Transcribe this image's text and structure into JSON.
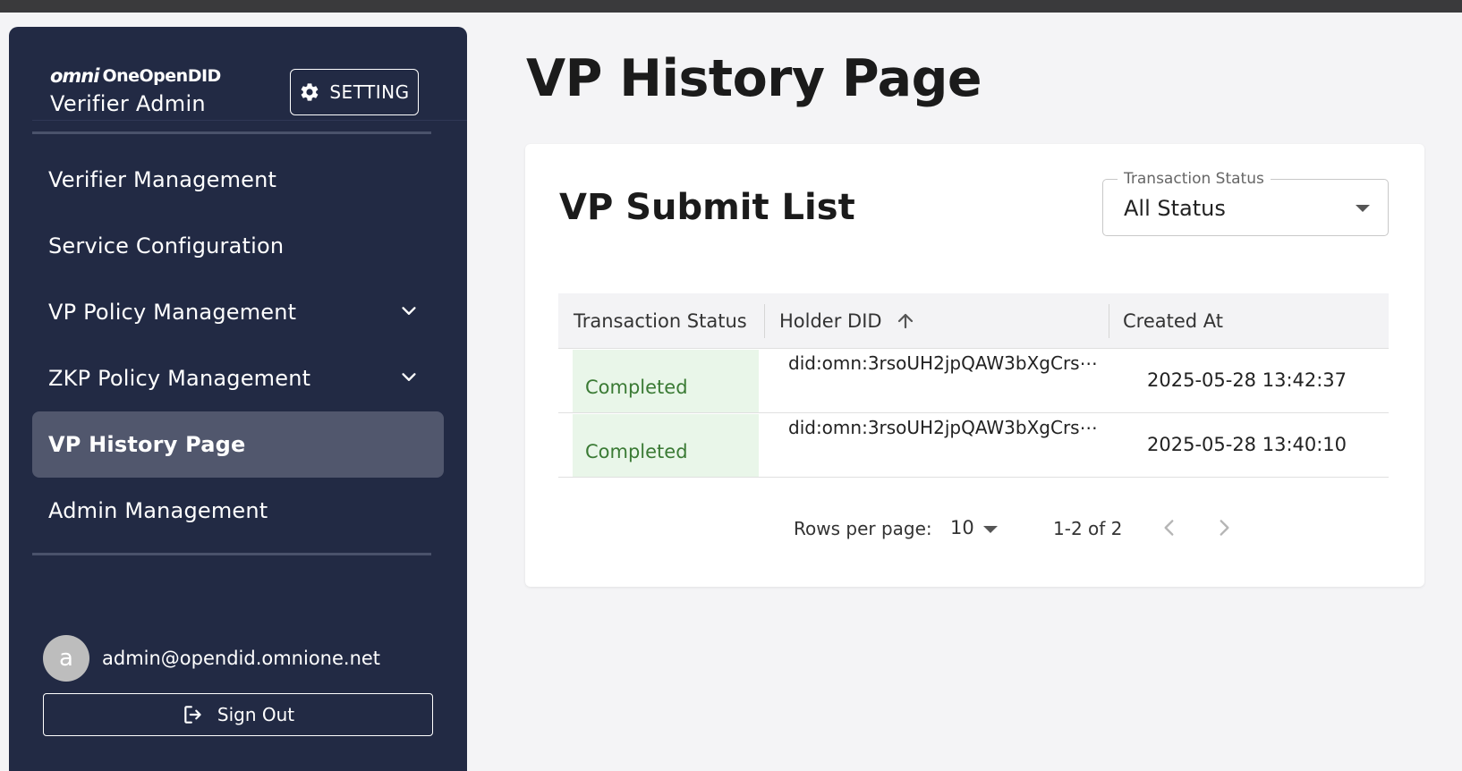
{
  "sidebar": {
    "logo_mark": "omni",
    "logo_text": "OneOpenDID",
    "app_name": "Verifier Admin",
    "setting_label": "SETTING",
    "nav": [
      {
        "label": "Verifier Management",
        "expandable": false,
        "active": false
      },
      {
        "label": "Service Configuration",
        "expandable": false,
        "active": false
      },
      {
        "label": "VP Policy Management",
        "expandable": true,
        "active": false
      },
      {
        "label": "ZKP Policy Management",
        "expandable": true,
        "active": false
      },
      {
        "label": "VP History Page",
        "expandable": false,
        "active": true
      },
      {
        "label": "Admin Management",
        "expandable": false,
        "active": false
      }
    ],
    "user": {
      "avatar_letter": "a",
      "email": "admin@opendid.omnione.net"
    },
    "signout_label": "Sign Out"
  },
  "main": {
    "page_title": "VP History Page",
    "card_title": "VP Submit List",
    "filter": {
      "label": "Transaction Status",
      "value": "All Status"
    },
    "table": {
      "columns": [
        "Transaction Status",
        "Holder DID",
        "Created At"
      ],
      "rows": [
        {
          "status": "Completed",
          "holder_did": "did:omn:3rsoUH2jpQAW3bXgCrs⋯",
          "created_at": "2025-05-28 13:42:37"
        },
        {
          "status": "Completed",
          "holder_did": "did:omn:3rsoUH2jpQAW3bXgCrs⋯",
          "created_at": "2025-05-28 13:40:10"
        }
      ]
    },
    "pagination": {
      "rows_per_page_label": "Rows per page:",
      "rows_per_page": "10",
      "range": "1-2 of 2"
    }
  },
  "colors": {
    "sidebar_bg": "#222a44",
    "active_item_bg": "#51576d",
    "status_completed_bg": "#e9f6e9",
    "status_completed_text": "#3a7a34"
  },
  "icons": [
    "gear-icon",
    "chevron-down-icon",
    "arrow-up-icon",
    "logout-icon",
    "chevron-left-icon",
    "chevron-right-icon"
  ]
}
